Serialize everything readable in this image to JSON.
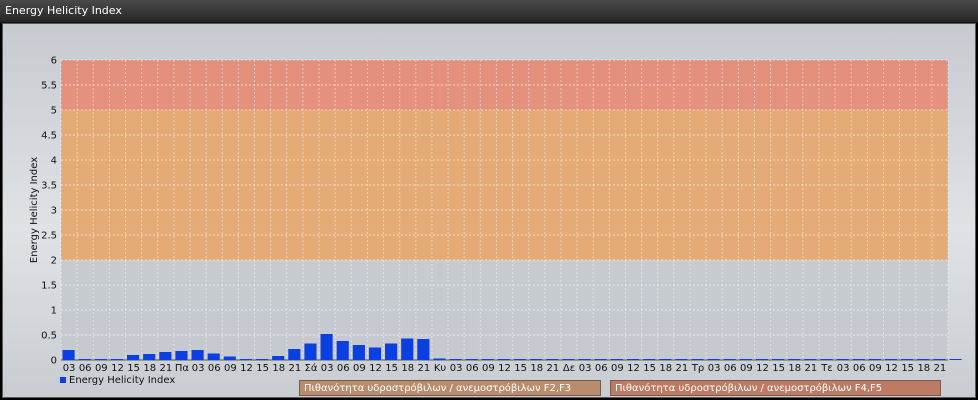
{
  "window": {
    "title": "Energy Helicity Index"
  },
  "chart_data": {
    "type": "bar",
    "ylabel": "Energy Helicity Index",
    "ylim": [
      0,
      6
    ],
    "yticks": [
      "0",
      "0.5",
      "1",
      "1.5",
      "2",
      "2.5",
      "3",
      "3.5",
      "4",
      "4.5",
      "5",
      "5.5",
      "6"
    ],
    "categories": [
      "03",
      "06",
      "09",
      "12",
      "15",
      "18",
      "21",
      "Πα",
      "03",
      "06",
      "09",
      "12",
      "15",
      "18",
      "21",
      "Σά",
      "03",
      "06",
      "09",
      "12",
      "15",
      "18",
      "21",
      "Κυ",
      "03",
      "06",
      "09",
      "12",
      "15",
      "18",
      "21",
      "Δε",
      "03",
      "06",
      "09",
      "12",
      "15",
      "18",
      "21",
      "Τρ",
      "03",
      "06",
      "09",
      "12",
      "15",
      "18",
      "21",
      "Τε",
      "03",
      "06",
      "09",
      "12",
      "15",
      "18",
      "21"
    ],
    "series": [
      {
        "name": "Energy Helicity Index",
        "color": "#0b3fe0",
        "values": [
          0.2,
          0.02,
          0.02,
          0.02,
          0.1,
          0.12,
          0.16,
          0.18,
          0.2,
          0.13,
          0.07,
          0.02,
          0.02,
          0.08,
          0.22,
          0.33,
          0.52,
          0.38,
          0.3,
          0.25,
          0.33,
          0.43,
          0.42,
          0.03,
          0.02,
          0.02,
          0.02,
          0.02,
          0.02,
          0.02,
          0.02,
          0.02,
          0.02,
          0.02,
          0.02,
          0.02,
          0.02,
          0.02,
          0.02,
          0.02,
          0.02,
          0.02,
          0.02,
          0.02,
          0.02,
          0.02,
          0.02,
          0.02,
          0.02,
          0.02,
          0.02,
          0.02,
          0.02,
          0.02,
          0.02,
          0.02
        ]
      }
    ],
    "zones": [
      {
        "from": 0,
        "to": 2,
        "color": "#c4c9ce"
      },
      {
        "from": 2,
        "to": 5,
        "color": "#e6a56a"
      },
      {
        "from": 5,
        "to": 6,
        "color": "#e68a73"
      }
    ],
    "grid": true,
    "legend_position": "bottom-left"
  },
  "zone_legend": {
    "f2f3": {
      "label": "Πιθανότητα υδροστρόβιλων / ανεμοστρόβιλων F2,F3",
      "color": "#b98c6e"
    },
    "f4f5": {
      "label": "Πιθανότητα υδροστρόβιλων / ανεμοστρόβιλων F4,F5",
      "color": "#bd7a64"
    }
  }
}
